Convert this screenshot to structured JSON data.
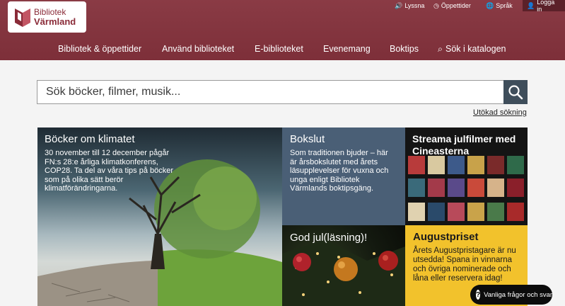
{
  "logo": {
    "line1": "Bibliotek",
    "line2": "Värmland"
  },
  "utility": {
    "listen": "Lyssna",
    "hours": "Öppettider",
    "language": "Språk",
    "login": "Logga in"
  },
  "nav": [
    "Bibliotek & öppettider",
    "Använd biblioteket",
    "E-biblioteket",
    "Evenemang",
    "Boktips",
    "Sök i katalogen"
  ],
  "search": {
    "placeholder": "Sök böcker, filmer, musik...",
    "advanced": "Utökad sökning"
  },
  "tiles": {
    "climate": {
      "title": "Böcker om klimatet",
      "text": "30 november till 12 december pågår FN:s 28:e årliga klimatkonferens, COP28. Ta del av våra tips på böcker som på olika sätt berör klimatförändringarna."
    },
    "bokslut": {
      "title": "Bokslut",
      "text": "Som traditionen bjuder – här är årsbokslutet med årets läsupplevelser för vuxna och unga enligt Bibliotek Värmlands boktipsgäng."
    },
    "stream": {
      "title": "Streama julfilmer med Cineasterna"
    },
    "jul": {
      "title": "God jul(läsning)!"
    },
    "august": {
      "title": "Augustpriset",
      "text": "Årets Augustpristagare är nu utsedda! Spana in vinnarna och övriga nominerade och låna eller reservera idag!"
    }
  },
  "faq": {
    "label": "Vanliga frågor och svar"
  },
  "colors": {
    "brand": "#7d2f39",
    "searchButton": "#3f4e5b",
    "bokslut": "#4a5f76",
    "august": "#f2c22c"
  }
}
